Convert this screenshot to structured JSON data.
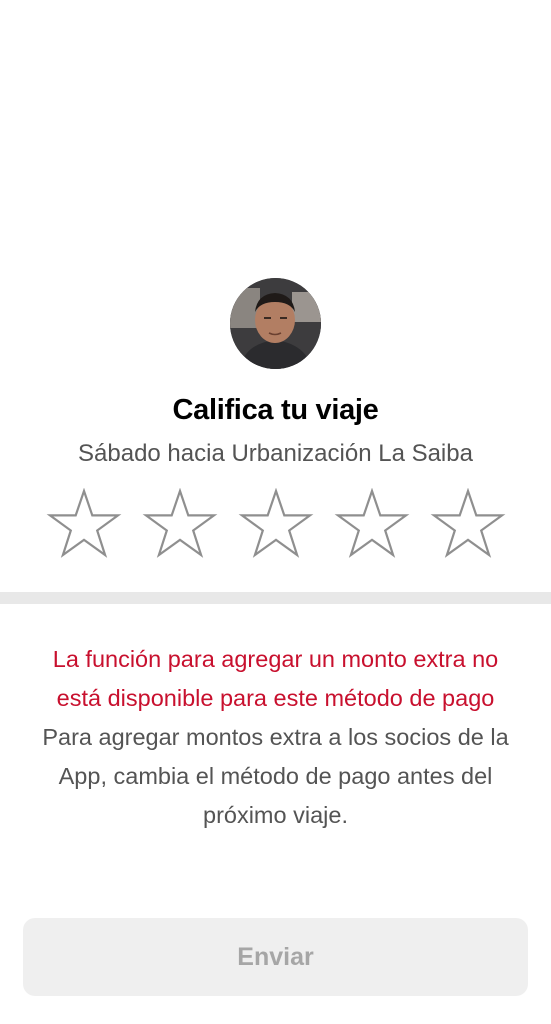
{
  "rating": {
    "title": "Califica tu viaje",
    "subtitle": "Sábado hacia Urbanización La Saiba",
    "stars_max": 5,
    "stars_selected": 0
  },
  "notice": {
    "warning_text": "La función para agregar un monto extra no está disponible para este método de pago",
    "info_text": " Para agregar montos extra a los socios de la App, cambia el método de pago antes del próximo viaje."
  },
  "submit": {
    "label": "Enviar"
  },
  "colors": {
    "warning": "#c8102e",
    "button_bg": "#efefef",
    "button_text": "#a6a6a6",
    "divider": "#e8e8e8"
  }
}
